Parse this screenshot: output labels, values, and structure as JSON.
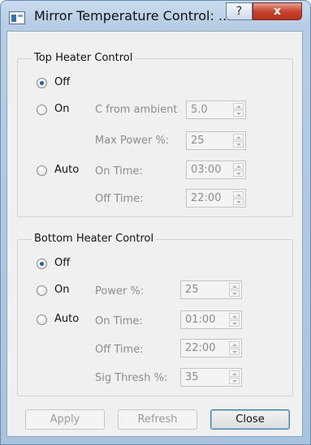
{
  "window": {
    "title": "Mirror Temperature Control: ...",
    "help_label": "?",
    "close_label": "x"
  },
  "top": {
    "group_title": "Top Heater Control",
    "off_label": "Off",
    "on_label": "On",
    "auto_label": "Auto",
    "selected": "Off",
    "c_from_ambient_label": "C from ambient",
    "c_from_ambient_value": "5.0",
    "max_power_label": "Max Power %:",
    "max_power_value": "25",
    "on_time_label": "On Time:",
    "on_time_value": "03:00",
    "off_time_label": "Off Time:",
    "off_time_value": "22:00"
  },
  "bottom": {
    "group_title": "Bottom Heater Control",
    "off_label": "Off",
    "on_label": "On",
    "auto_label": "Auto",
    "selected": "Off",
    "power_label": "Power %:",
    "power_value": "25",
    "on_time_label": "On Time:",
    "on_time_value": "01:00",
    "off_time_label": "Off Time:",
    "off_time_value": "22:00",
    "sig_thresh_label": "Sig Thresh %:",
    "sig_thresh_value": "35"
  },
  "buttons": {
    "apply": "Apply",
    "refresh": "Refresh",
    "close": "Close"
  },
  "colors": {
    "accent": "#1f5fa8",
    "title_close_red": "#c9452f",
    "disabled_text": "#8c8c8c"
  }
}
